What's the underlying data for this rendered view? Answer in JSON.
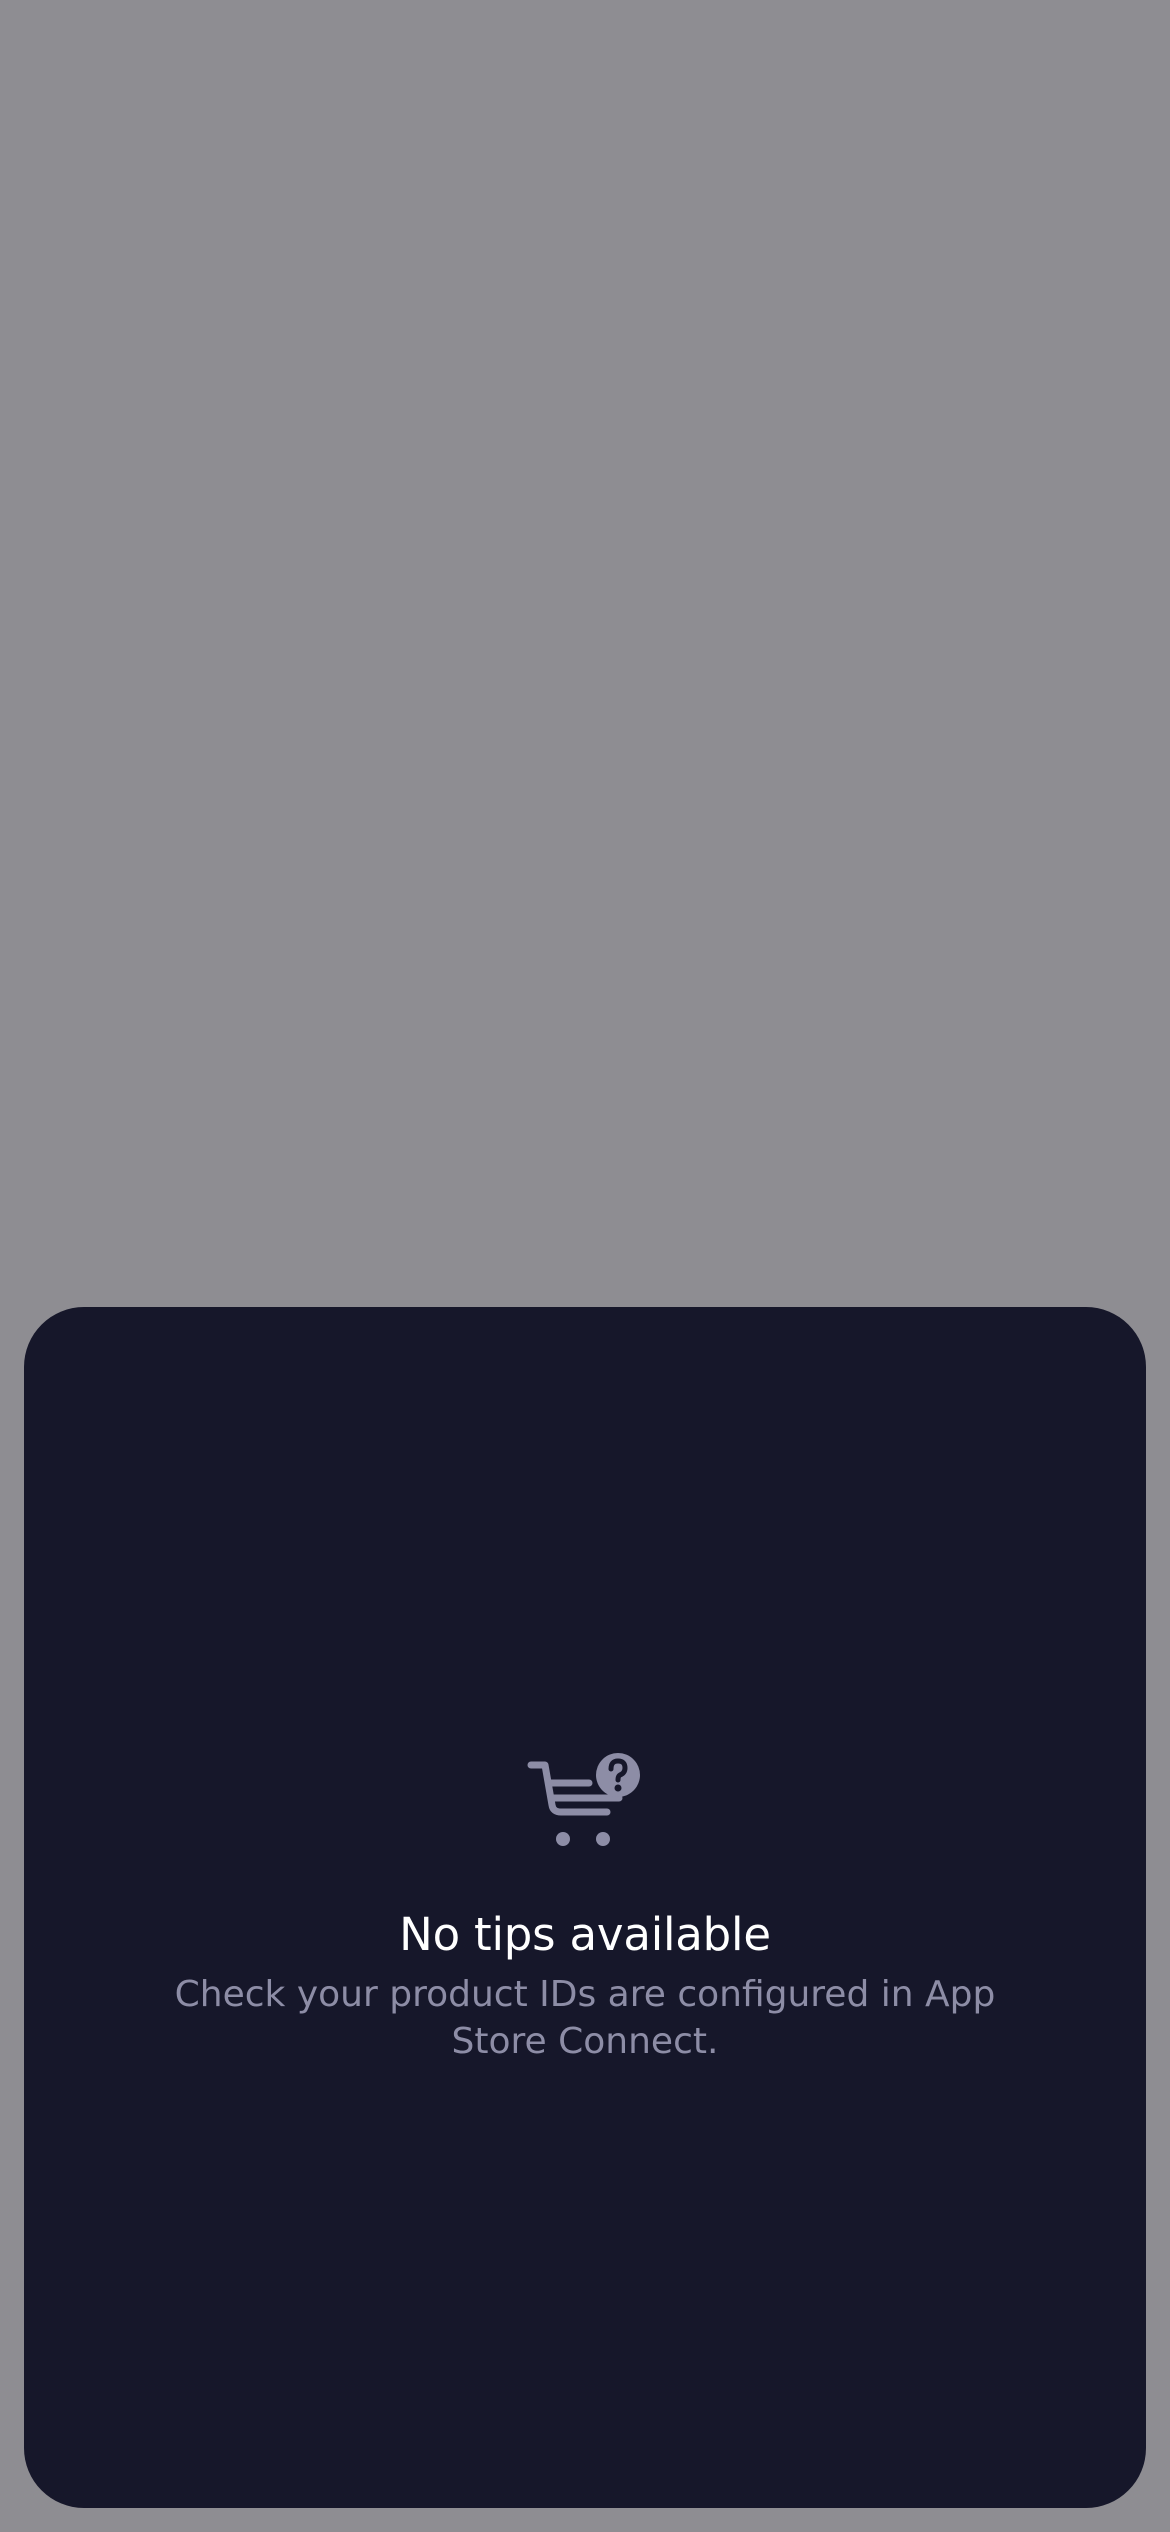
{
  "colors": {
    "backdrop": "#8e8d92",
    "sheet_background": "#16172a",
    "title_text": "#ffffff",
    "message_text": "#8d8da6",
    "icon": "#8d8da6"
  },
  "sheet": {
    "icon": "cart-question-icon",
    "title": "No tips available",
    "message": "Check your product IDs are configured in App Store Connect."
  }
}
